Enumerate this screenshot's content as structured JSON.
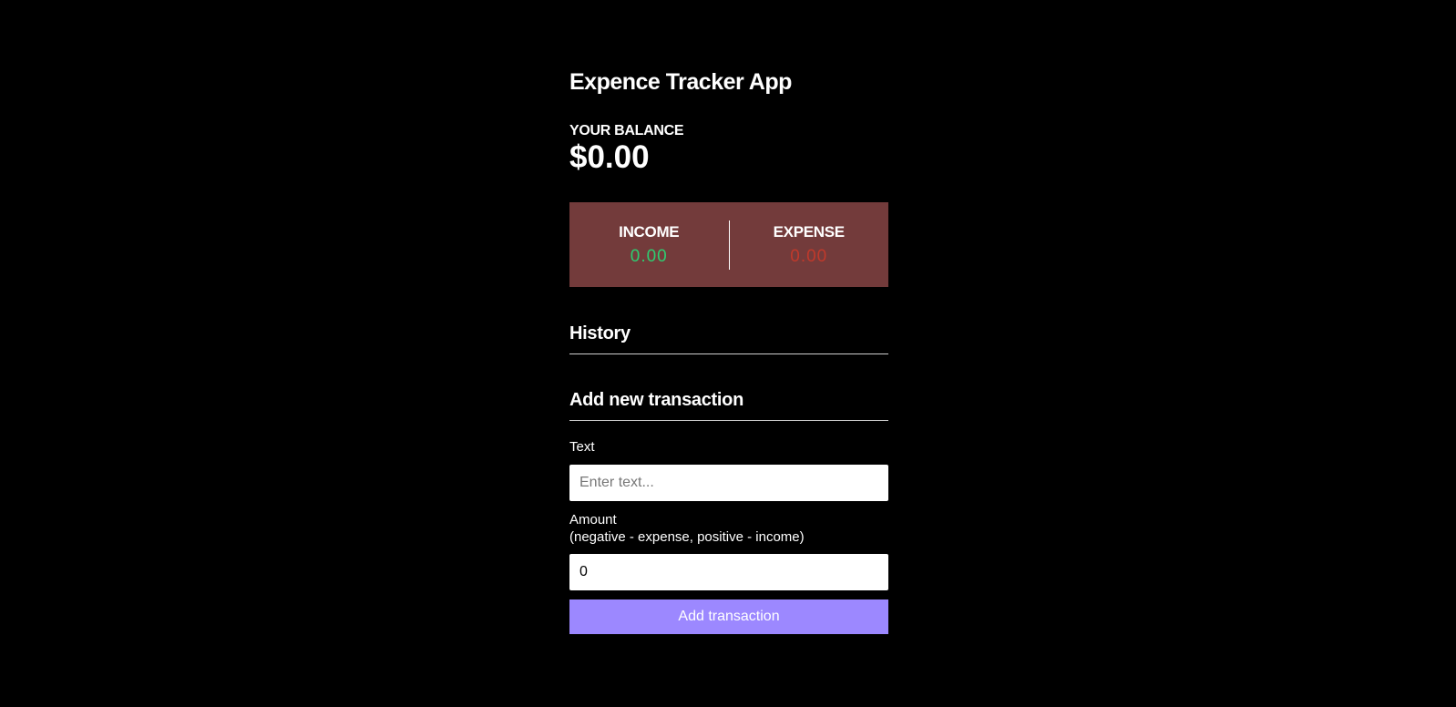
{
  "app": {
    "title": "Expence Tracker App"
  },
  "balance": {
    "label": "YOUR BALANCE",
    "value": "$0.00"
  },
  "summary": {
    "income_label": "INCOME",
    "income_value": "0.00",
    "expense_label": "EXPENSE",
    "expense_value": "0.00"
  },
  "history": {
    "title": "History",
    "items": []
  },
  "form": {
    "title": "Add new transaction",
    "text_label": "Text",
    "text_placeholder": "Enter text...",
    "text_value": "",
    "amount_label_line1": "Amount",
    "amount_label_line2": "(negative - expense, positive - income)",
    "amount_value": "0",
    "submit_label": "Add transaction"
  },
  "colors": {
    "background": "#000000",
    "summary_panel": "#733b3b",
    "income": "#2ecc71",
    "expense": "#c0392b",
    "button": "#9c88ff"
  }
}
